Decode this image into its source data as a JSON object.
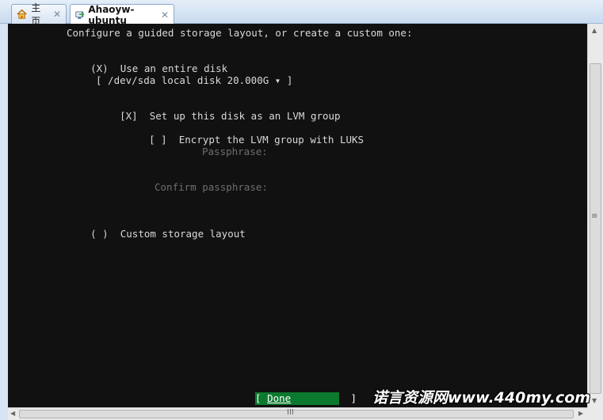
{
  "tabs": [
    {
      "label": "主页",
      "icon": "home-icon",
      "close": "✕"
    },
    {
      "label": "Ahaoyw-ubuntu",
      "icon": "vm-icon",
      "close": "✕"
    }
  ],
  "console": {
    "heading": "Configure a guided storage layout, or create a custom one:",
    "entire_disk": {
      "marker": "(X)",
      "label": "Use an entire disk"
    },
    "disk_select": "[ /dev/sda local disk 20.000G ▾ ]",
    "lvm": {
      "marker": "[X]",
      "label": "Set up this disk as an LVM group"
    },
    "encrypt": {
      "marker": "[ ]",
      "label": "Encrypt the LVM group with LUKS"
    },
    "passphrase_label": "Passphrase:",
    "confirm_label": "Confirm passphrase:",
    "custom": {
      "marker": "( )",
      "label": "Custom storage layout"
    },
    "done_button": {
      "open": "[ ",
      "label": "Done",
      "close": "]"
    }
  },
  "scrollbars": {
    "up": "▲",
    "down": "▼",
    "left": "◀",
    "right": "▶",
    "grip_v": "≡",
    "grip_h": "III"
  },
  "watermark": "诺言资源网www.440my.com",
  "colors": {
    "console_bg": "#111111",
    "text": "#d9d9d9",
    "dim_text": "#6e6e6e",
    "done_bg": "#0c7a2e"
  }
}
